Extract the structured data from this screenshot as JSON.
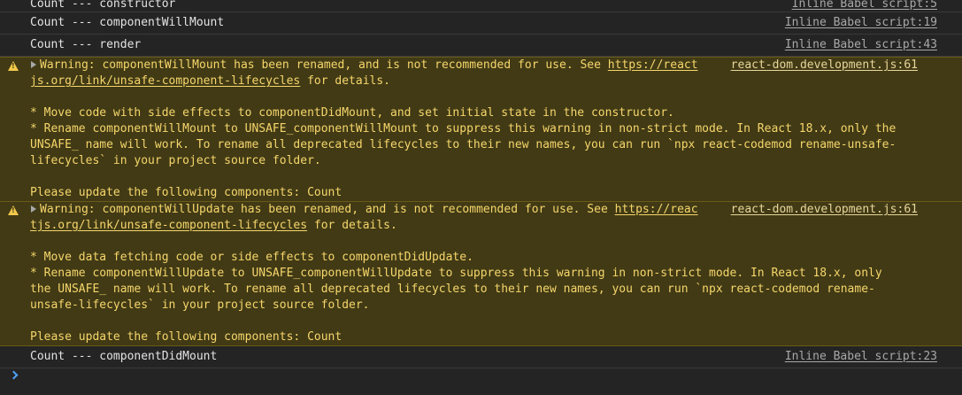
{
  "logs": [
    {
      "text": "Count --- constructor",
      "source": "Inline Babel script:5"
    },
    {
      "text": "Count --- componentWillMount",
      "source": "Inline Babel script:19"
    },
    {
      "text": "Count --- render",
      "source": "Inline Babel script:43"
    }
  ],
  "warnings": [
    {
      "line1_text": "Warning: componentWillMount has been renamed, and is not recommended for use. See ",
      "line1_url": "https://react",
      "source": "react-dom.development.js:61",
      "line2_url": "js.org/link/unsafe-component-lifecycles",
      "line2_text": " for details.",
      "bullet1": "* Move code with side effects to componentDidMount, and set initial state in the constructor.",
      "bullet2a": "* Rename componentWillMount to UNSAFE_componentWillMount to suppress this warning in non-strict mode. In React 18.x, only the",
      "bullet2b": "UNSAFE_ name will work. To rename all deprecated lifecycles to their new names, you can run `npx react-codemod rename-unsafe-",
      "bullet2c": "lifecycles` in your project source folder.",
      "footer": "Please update the following components: Count"
    },
    {
      "line1_text": "Warning: componentWillUpdate has been renamed, and is not recommended for use. See ",
      "line1_url": "https://reac",
      "source": "react-dom.development.js:61",
      "line2_url": "tjs.org/link/unsafe-component-lifecycles",
      "line2_text": " for details.",
      "bullet1": "* Move data fetching code or side effects to componentDidUpdate.",
      "bullet2a": "* Rename componentWillUpdate to UNSAFE_componentWillUpdate to suppress this warning in non-strict mode. In React 18.x, only",
      "bullet2b": "the UNSAFE_ name will work. To rename all deprecated lifecycles to their new names, you can run `npx react-codemod rename-",
      "bullet2c": "unsafe-lifecycles` in your project source folder.",
      "footer": "Please update the following components: Count"
    }
  ],
  "final_log": {
    "text": "Count --- componentDidMount",
    "source": "Inline Babel script:23"
  }
}
